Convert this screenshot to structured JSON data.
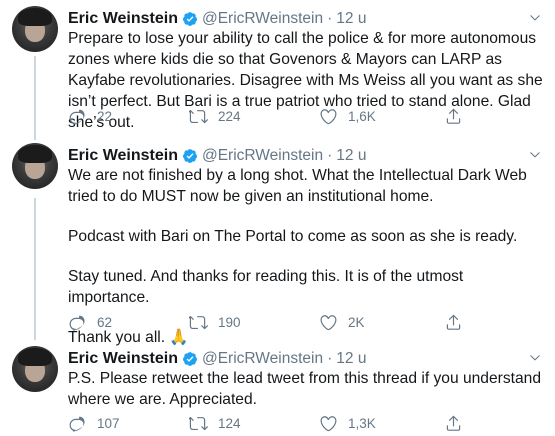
{
  "tweets": [
    {
      "name": "Eric Weinstein",
      "handle": "@EricRWeinstein",
      "separator": "·",
      "time": "12 u",
      "text": [
        "Prepare to lose your ability to call the police & for more autonomous zones where kids die so that Govenors & Mayors can LARP as Kayfabe revolutionaries. Disagree with Ms Weiss all you want as she isn’t perfect. But Bari is a true patriot who tried to stand alone. Glad she’s out."
      ],
      "replies": "22",
      "retweets": "224",
      "likes": "1,6K"
    },
    {
      "name": "Eric Weinstein",
      "handle": "@EricRWeinstein",
      "separator": "·",
      "time": "12 u",
      "text": [
        "We are not finished by a long shot. What the Intellectual Dark Web tried to do MUST now be given an institutional home.",
        "Podcast with Bari on The Portal to come as soon as she is ready.",
        "Stay tuned. And thanks for reading this. It is of the utmost importance.",
        "Thank you all. 🙏"
      ],
      "replies": "62",
      "retweets": "190",
      "likes": "2K"
    },
    {
      "name": "Eric Weinstein",
      "handle": "@EricRWeinstein",
      "separator": "·",
      "time": "12 u",
      "text": [
        "P.S. Please retweet the lead tweet from this thread if you understand where we are. Appreciated."
      ],
      "replies": "107",
      "retweets": "124",
      "likes": "1,3K"
    }
  ],
  "icons": {
    "verified": "verified-badge-icon",
    "caret": "chevron-down-icon",
    "reply": "reply-icon",
    "retweet": "retweet-icon",
    "like": "heart-icon",
    "share": "share-icon"
  },
  "colors": {
    "accent": "#1da1f2",
    "text": "#14171a",
    "muted": "#657786",
    "thread_line": "#ccd6dd",
    "background": "#ffffff"
  }
}
